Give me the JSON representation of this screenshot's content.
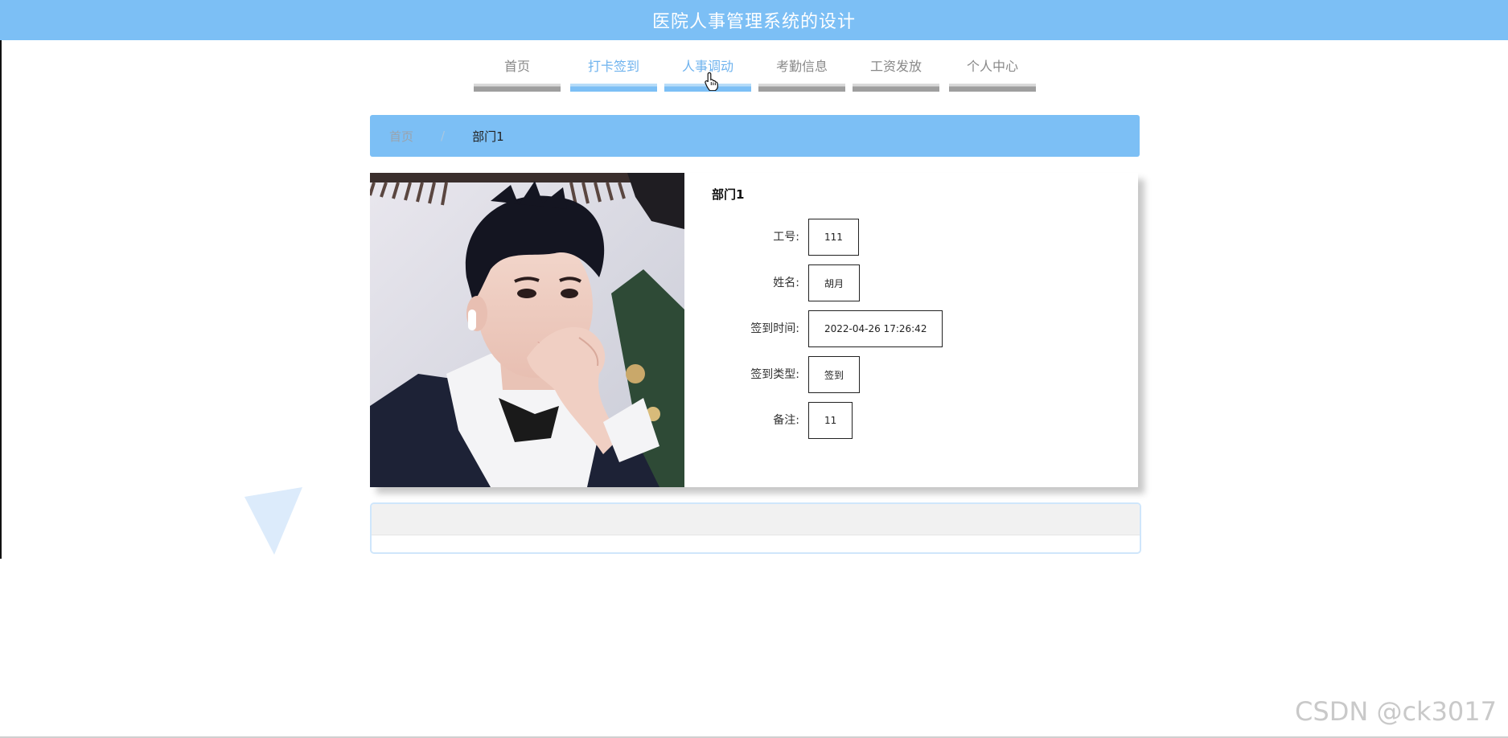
{
  "header": {
    "title": "医院人事管理系统的设计"
  },
  "nav": {
    "items": [
      {
        "label": "首页",
        "active": false
      },
      {
        "label": "打卡签到",
        "active": true
      },
      {
        "label": "人事调动",
        "active": true
      },
      {
        "label": "考勤信息",
        "active": false
      },
      {
        "label": "工资发放",
        "active": false
      },
      {
        "label": "个人中心",
        "active": false
      }
    ]
  },
  "breadcrumb": {
    "home": "首页",
    "separator": "/",
    "current": "部门1"
  },
  "detail": {
    "title": "部门1",
    "fields": [
      {
        "label": "工号:",
        "value": "111"
      },
      {
        "label": "姓名:",
        "value": "胡月"
      },
      {
        "label": "签到时间:",
        "value": "2022-04-26 17:26:42"
      },
      {
        "label": "签到类型:",
        "value": "签到"
      },
      {
        "label": "备注:",
        "value": "11"
      }
    ]
  },
  "watermark": "CSDN @ck3017",
  "colors": {
    "accent": "#7cbff5",
    "active_text": "#6fb3ee",
    "nav_text": "#888888"
  }
}
